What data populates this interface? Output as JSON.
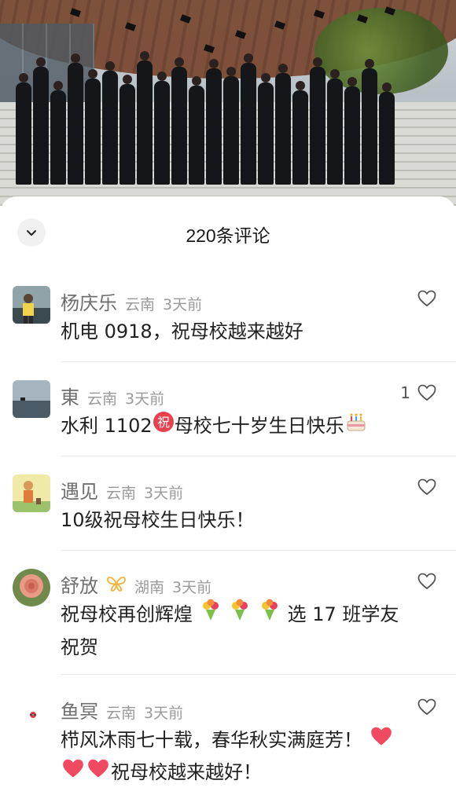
{
  "sheet": {
    "title": "220条评论"
  },
  "comments": [
    {
      "name": "杨庆乐",
      "location": "云南",
      "time": "3天前",
      "content": "机电 0918，祝母校越来越好",
      "likes": ""
    },
    {
      "name": "東",
      "location": "云南",
      "time": "3天前",
      "content_a": "水利 1102",
      "content_b": "母校七十岁生日快乐",
      "likes": "1"
    },
    {
      "name": "遇见",
      "location": "云南",
      "time": "3天前",
      "content": "10级祝母校生日快乐！",
      "likes": ""
    },
    {
      "name": "舒放",
      "location": "湖南",
      "time": "3天前",
      "content_a": "祝母校再创辉煌",
      "content_b": "选 17 班学友",
      "content_c": "祝贺",
      "likes": ""
    },
    {
      "name": "鱼冥",
      "location": "云南",
      "time": "3天前",
      "content_a": "栉风沐雨七十载，春华秋实满庭芳！",
      "content_b": "祝母校越来越好！",
      "likes": ""
    }
  ],
  "emoji": {
    "zhu": "祝"
  },
  "colors": {
    "accent_red": "#e8404f",
    "text_gray": "#9a9a9a"
  }
}
